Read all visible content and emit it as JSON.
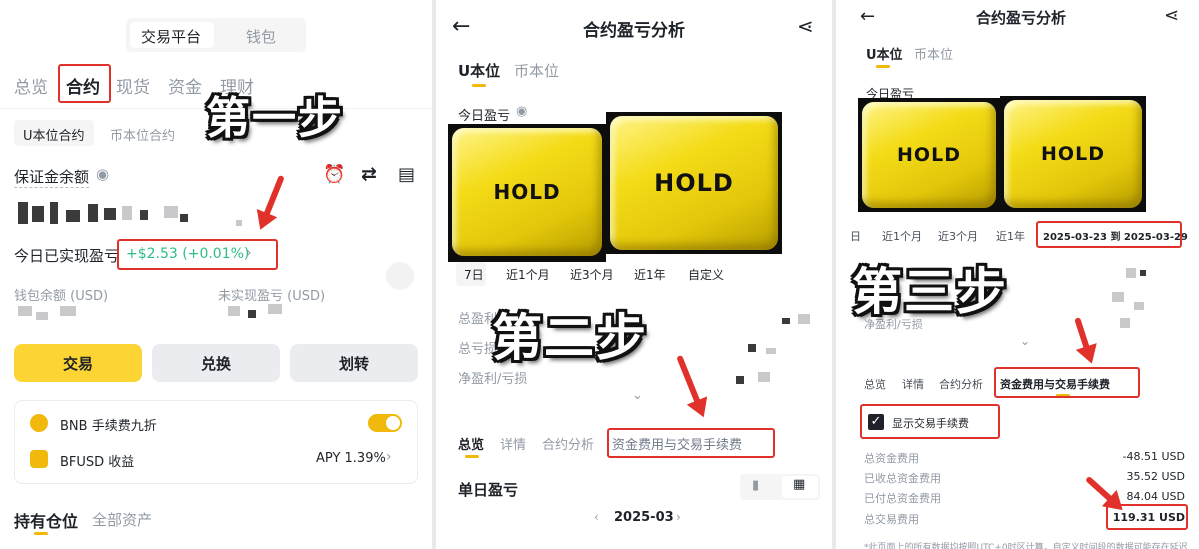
{
  "panel1": {
    "seg_trade": "交易平台",
    "seg_wallet": "钱包",
    "tabs": [
      "总览",
      "合约",
      "现货",
      "资金",
      "理财"
    ],
    "subtabs": [
      "U本位合约",
      "币本位合约"
    ],
    "margin_label": "保证金余额",
    "today_label": "今日已实现盈亏",
    "today_value": "+$2.53 (+0.01%)",
    "wallet_label": "钱包余额 (USD)",
    "unrealized_label": "未实现盈亏 (USD)",
    "btn_trade": "交易",
    "btn_convert": "兑换",
    "btn_transfer": "划转",
    "bnb_label": "BNB 手续费九折",
    "bfusd_label": "BFUSD 收益",
    "bfusd_apy": "APY 1.39%",
    "hold_tab": "持有仓位",
    "all_tab": "全部资产",
    "step": "第一步"
  },
  "panel2": {
    "title": "合约盈亏分析",
    "tabs": [
      "U本位",
      "币本位"
    ],
    "today_label": "今日盈亏",
    "hold1": "HOLD",
    "hold2": "HOLD",
    "ranges": [
      "7日",
      "近1个月",
      "近3个月",
      "近1年",
      "自定义"
    ],
    "stat1": "总盈利",
    "stat2": "总亏损",
    "stat3": "净盈利/亏损",
    "bottom_tabs": [
      "总览",
      "详情",
      "合约分析",
      "资金费用与交易手续费"
    ],
    "daily_label": "单日盈亏",
    "month": "2025-03",
    "step": "第二步"
  },
  "panel3": {
    "title": "合约盈亏分析",
    "tabs": [
      "U本位",
      "币本位"
    ],
    "today_label": "今日盈亏",
    "hold1": "HOLD",
    "hold2": "HOLD",
    "ranges": [
      "日",
      "近1个月",
      "近3个月",
      "近1年"
    ],
    "date_range": "2025-03-23 到 2025-03-29",
    "net_label": "净盈利/亏损",
    "bottom_tabs": [
      "总览",
      "详情",
      "合约分析",
      "资金费用与交易手续费"
    ],
    "show_fee": "显示交易手续费",
    "rows": [
      {
        "label": "总资金费用",
        "value": "-48.51 USD"
      },
      {
        "label": "已收总资金费用",
        "value": "35.52 USD"
      },
      {
        "label": "已付总资金费用",
        "value": "84.04 USD"
      },
      {
        "label": "总交易费用",
        "value": "119.31 USD"
      }
    ],
    "footnote": "*此页面上的所有数据均按照UTC+0时区计算，自定义时间段的数据可能存在延迟",
    "step": "第三步"
  }
}
